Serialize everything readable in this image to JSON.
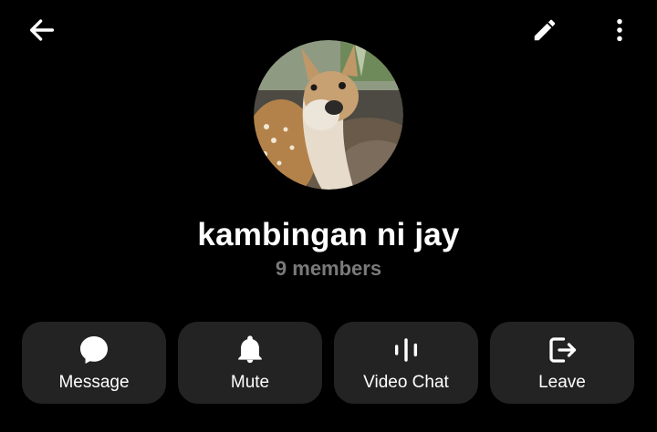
{
  "header": {
    "back_icon": "arrow-left-icon",
    "edit_icon": "pencil-icon",
    "more_icon": "more-vertical-icon"
  },
  "profile": {
    "name": "kambingan ni jay",
    "members": "9 members"
  },
  "actions": [
    {
      "label": "Message",
      "icon": "message-bubble-icon"
    },
    {
      "label": "Mute",
      "icon": "bell-icon"
    },
    {
      "label": "Video Chat",
      "icon": "audio-bars-icon"
    },
    {
      "label": "Leave",
      "icon": "leave-icon"
    }
  ],
  "colors": {
    "background": "#000000",
    "button_bg": "#232323",
    "muted_text": "#7a7a7a",
    "text": "#ffffff"
  }
}
